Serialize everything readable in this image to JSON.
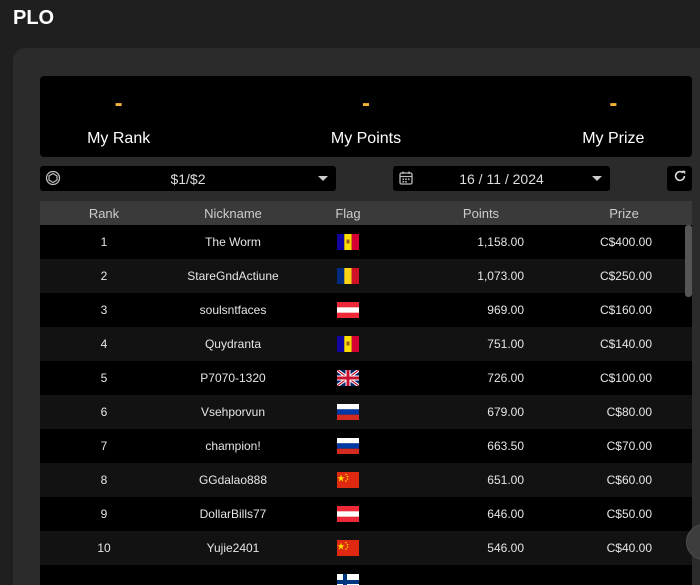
{
  "page": {
    "title": "PLO"
  },
  "stats": [
    {
      "value": "-",
      "label": "My Rank"
    },
    {
      "value": "-",
      "label": "My Points"
    },
    {
      "value": "-",
      "label": "My Prize"
    }
  ],
  "filters": {
    "stakes": {
      "value": "$1/$2",
      "icon": "chip-icon"
    },
    "date": {
      "value": "16 / 11 / 2024",
      "icon": "calendar-icon"
    },
    "refresh_icon": "refresh-icon"
  },
  "table": {
    "headers": {
      "rank": "Rank",
      "nickname": "Nickname",
      "flag": "Flag",
      "points": "Points",
      "prize": "Prize"
    },
    "rows": [
      {
        "rank": "1",
        "nickname": "The Worm",
        "flag": "andorra",
        "points": "1,158.00",
        "prize": "C$400.00"
      },
      {
        "rank": "2",
        "nickname": "StareGndActiune",
        "flag": "romania",
        "points": "1,073.00",
        "prize": "C$250.00"
      },
      {
        "rank": "3",
        "nickname": "soulsntfaces",
        "flag": "austria",
        "points": "969.00",
        "prize": "C$160.00"
      },
      {
        "rank": "4",
        "nickname": "Quydranta",
        "flag": "andorra",
        "points": "751.00",
        "prize": "C$140.00"
      },
      {
        "rank": "5",
        "nickname": "P7070-1320",
        "flag": "uk",
        "points": "726.00",
        "prize": "C$100.00"
      },
      {
        "rank": "6",
        "nickname": "Vsehporvun",
        "flag": "russia",
        "points": "679.00",
        "prize": "C$80.00"
      },
      {
        "rank": "7",
        "nickname": "champion!",
        "flag": "russia",
        "points": "663.50",
        "prize": "C$70.00"
      },
      {
        "rank": "8",
        "nickname": "GGdalao888",
        "flag": "china",
        "points": "651.00",
        "prize": "C$60.00"
      },
      {
        "rank": "9",
        "nickname": "DollarBills77",
        "flag": "austria",
        "points": "646.00",
        "prize": "C$50.00"
      },
      {
        "rank": "10",
        "nickname": "Yujie2401",
        "flag": "china",
        "points": "546.00",
        "prize": "C$40.00"
      },
      {
        "rank": "",
        "nickname": "",
        "flag": "finland",
        "points": "",
        "prize": ""
      }
    ]
  },
  "colors": {
    "accent": "#f4b13a",
    "background": "#1f1f1f",
    "panel": "#2b2b2b"
  }
}
